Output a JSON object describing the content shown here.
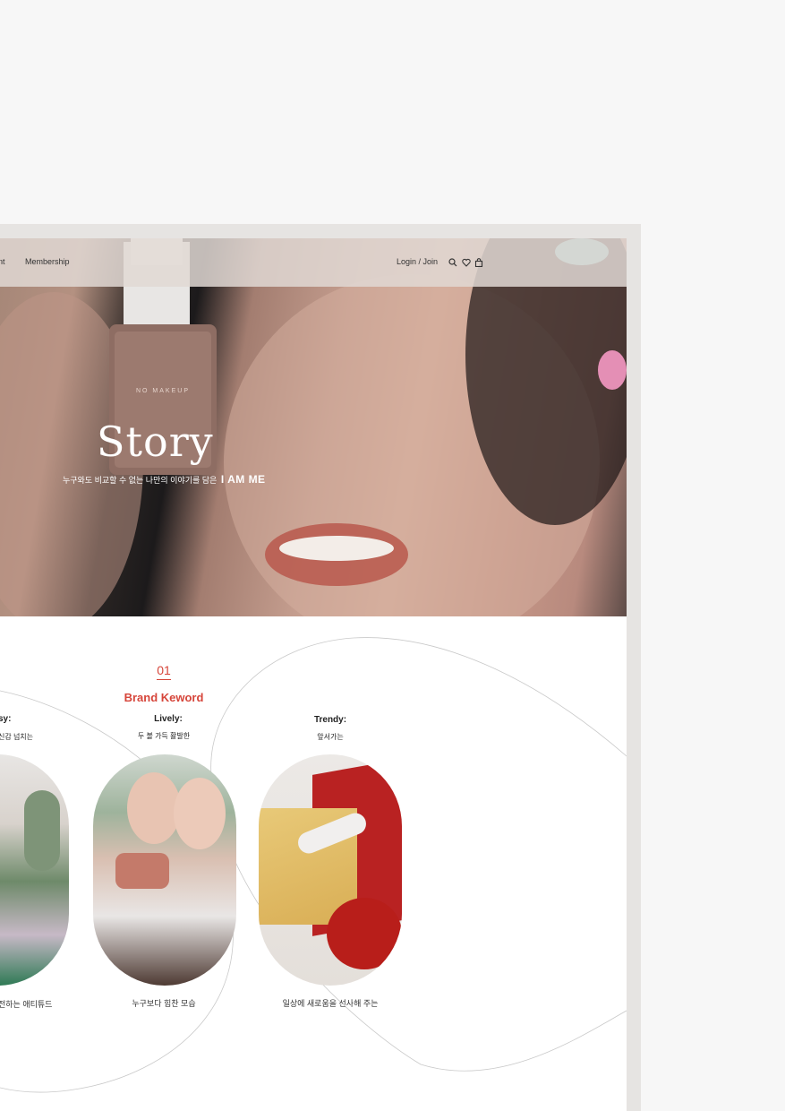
{
  "nav": {
    "item_partial": "nt",
    "membership": "Membership",
    "login_join": "Login / Join",
    "icons": [
      "search-icon",
      "heart-icon",
      "bag-icon"
    ]
  },
  "hero": {
    "title": "Story",
    "subtitle": "누구와도 비교할 수 없는 나만의 이야기를 담은",
    "brand": "I AM ME",
    "product_label": "NO MAKEUP"
  },
  "keyword_section": {
    "number": "01",
    "title": "Brand Keword",
    "accent_color": "#d6453a",
    "items": [
      {
        "word": "sy:",
        "desc": "신감 넘치는",
        "caption": "전하는 애티튜드"
      },
      {
        "word": "Lively:",
        "desc": "두 볼 가득 활발한",
        "caption": "누구보다 힘찬 모습"
      },
      {
        "word": "Trendy:",
        "desc": "앞서가는",
        "caption": "일상에 새로움을 선사해 주는"
      }
    ]
  }
}
